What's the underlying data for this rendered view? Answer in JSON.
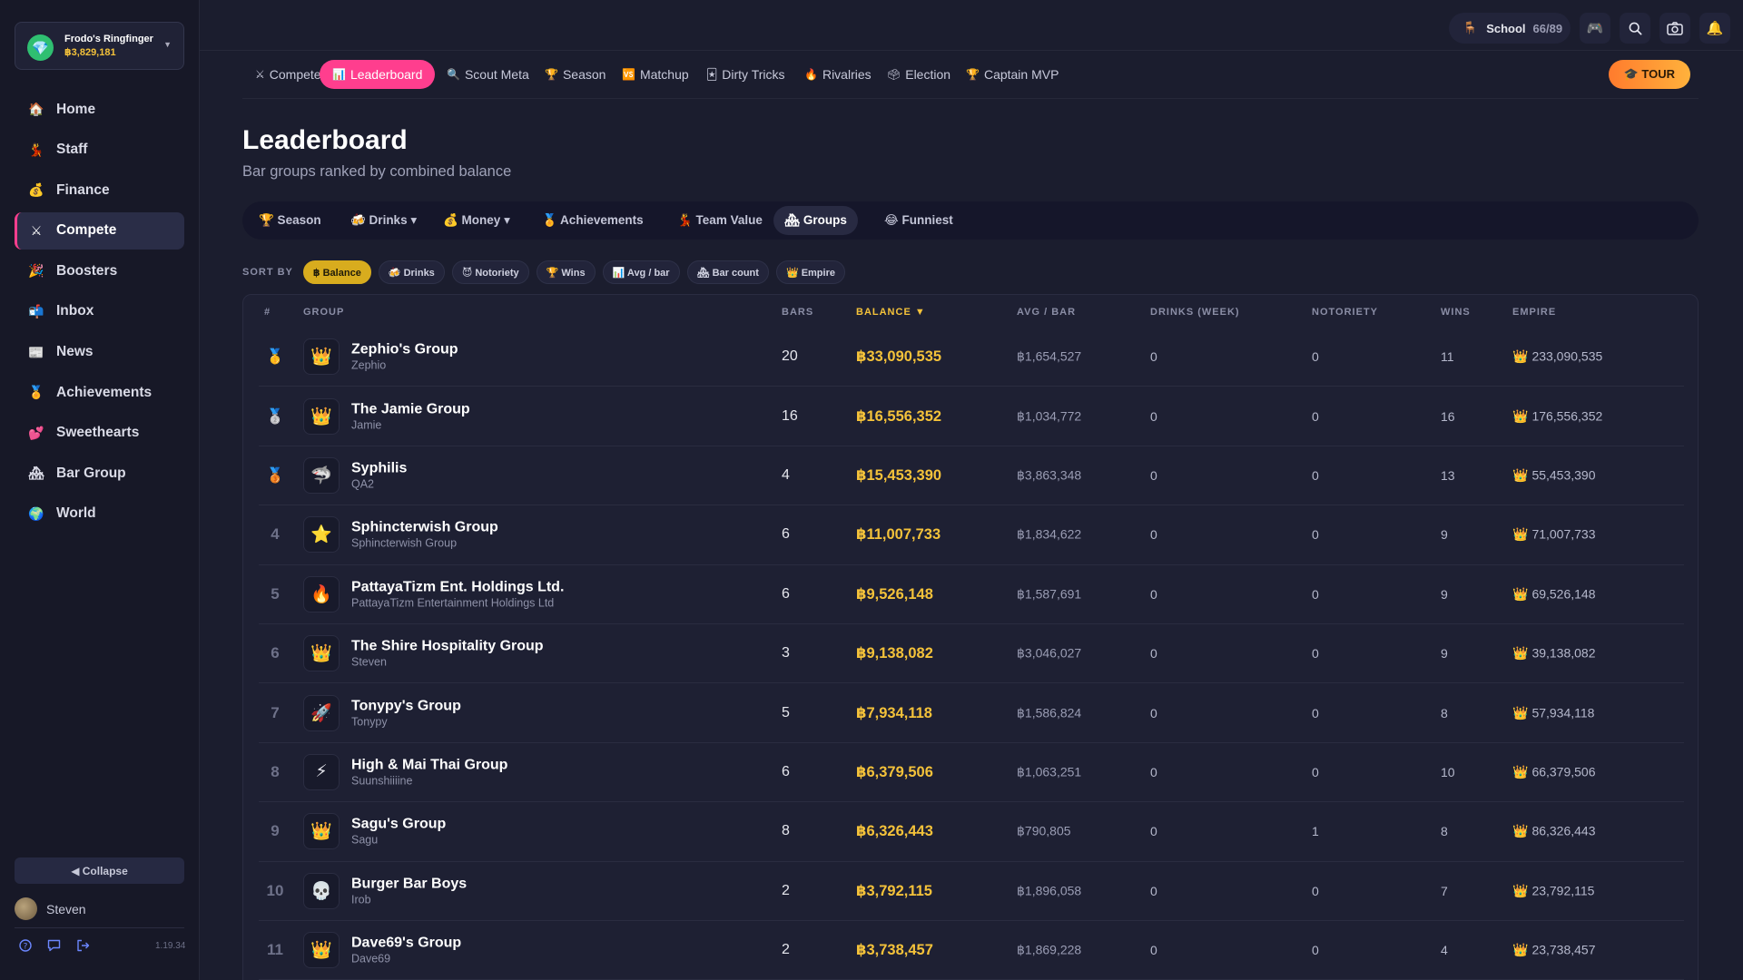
{
  "account": {
    "name": "Frodo's Ringfinger",
    "balance": "฿3,829,181",
    "icon": "diamond-icon"
  },
  "sidebar": {
    "items": [
      {
        "icon": "🏠",
        "label": "Home",
        "name": "sidebar-item-home"
      },
      {
        "icon": "💃",
        "label": "Staff",
        "name": "sidebar-item-staff"
      },
      {
        "icon": "💰",
        "label": "Finance",
        "name": "sidebar-item-finance"
      },
      {
        "icon": "⚔",
        "label": "Compete",
        "name": "sidebar-item-compete",
        "active": true
      },
      {
        "icon": "🎉",
        "label": "Boosters",
        "name": "sidebar-item-boosters"
      },
      {
        "icon": "📬",
        "label": "Inbox",
        "name": "sidebar-item-inbox"
      },
      {
        "icon": "📰",
        "label": "News",
        "name": "sidebar-item-news"
      },
      {
        "icon": "🏅",
        "label": "Achievements",
        "name": "sidebar-item-achievements"
      },
      {
        "icon": "💕",
        "label": "Sweethearts",
        "name": "sidebar-item-sweethearts"
      },
      {
        "icon": "🏘",
        "label": "Bar Group",
        "name": "sidebar-item-bar-group"
      },
      {
        "icon": "🌍",
        "label": "World",
        "name": "sidebar-item-world"
      }
    ],
    "collapse_label": "◀ Collapse",
    "user_name": "Steven",
    "version": "1.19.34"
  },
  "topbar": {
    "school_label": "School",
    "school_count": "66/89"
  },
  "tabs": [
    {
      "icon": "⚔",
      "label": "Compete"
    },
    {
      "icon": "📊",
      "label": "Leaderboard",
      "active": true
    },
    {
      "icon": "🔍",
      "label": "Scout Meta"
    },
    {
      "icon": "🏆",
      "label": "Season"
    },
    {
      "icon": "🆚",
      "label": "Matchup"
    },
    {
      "icon": "🃏",
      "label": "Dirty Tricks"
    },
    {
      "icon": "🔥",
      "label": "Rivalries"
    },
    {
      "icon": "🗳",
      "label": "Election"
    },
    {
      "icon": "🏆",
      "label": "Captain MVP"
    }
  ],
  "tour_label": "🎓 TOUR",
  "page": {
    "title": "Leaderboard",
    "subtitle": "Bar groups ranked by combined balance"
  },
  "subtabs": [
    {
      "label": "🏆 Season"
    },
    {
      "label": "🍻 Drinks ▾"
    },
    {
      "label": "💰 Money ▾"
    },
    {
      "label": "🏅 Achievements"
    },
    {
      "label": "💃 Team Value"
    },
    {
      "label": "🏘 Groups",
      "active": true
    },
    {
      "label": "😂 Funniest"
    }
  ],
  "sort": {
    "label": "SORT BY",
    "chips": [
      {
        "label": "฿ Balance",
        "active": true
      },
      {
        "label": "🍻 Drinks"
      },
      {
        "label": "😈 Notoriety"
      },
      {
        "label": "🏆 Wins"
      },
      {
        "label": "📊 Avg / bar"
      },
      {
        "label": "🏘 Bar count"
      },
      {
        "label": "👑 Empire"
      }
    ]
  },
  "table": {
    "headers": {
      "rank": "#",
      "group": "GROUP",
      "bars": "BARS",
      "balance": "BALANCE ▼",
      "avg": "AVG / BAR",
      "drinks": "DRINKS (WEEK)",
      "notoriety": "NOTORIETY",
      "wins": "WINS",
      "empire": "EMPIRE"
    },
    "rows": [
      {
        "rank": "🥇",
        "medal": true,
        "icon": "👑",
        "name": "Zephio's Group",
        "owner": "Zephio",
        "bars": "20",
        "balance": "฿33,090,535",
        "avg": "฿1,654,527",
        "drinks": "0",
        "notoriety": "0",
        "wins": "11",
        "empire": "233,090,535"
      },
      {
        "rank": "🥈",
        "medal": true,
        "icon": "👑",
        "name": "The Jamie Group",
        "owner": "Jamie",
        "bars": "16",
        "balance": "฿16,556,352",
        "avg": "฿1,034,772",
        "drinks": "0",
        "notoriety": "0",
        "wins": "16",
        "empire": "176,556,352"
      },
      {
        "rank": "🥉",
        "medal": true,
        "icon": "🦈",
        "name": "Syphilis",
        "owner": "QA2",
        "bars": "4",
        "balance": "฿15,453,390",
        "avg": "฿3,863,348",
        "drinks": "0",
        "notoriety": "0",
        "wins": "13",
        "empire": "55,453,390"
      },
      {
        "rank": "4",
        "icon": "⭐",
        "name": "Sphincterwish Group",
        "owner": "Sphincterwish Group",
        "bars": "6",
        "balance": "฿11,007,733",
        "avg": "฿1,834,622",
        "drinks": "0",
        "notoriety": "0",
        "wins": "9",
        "empire": "71,007,733"
      },
      {
        "rank": "5",
        "icon": "🔥",
        "name": "PattayaTizm Ent. Holdings Ltd.",
        "owner": "PattayaTizm Entertainment Holdings Ltd",
        "bars": "6",
        "balance": "฿9,526,148",
        "avg": "฿1,587,691",
        "drinks": "0",
        "notoriety": "0",
        "wins": "9",
        "empire": "69,526,148"
      },
      {
        "rank": "6",
        "icon": "👑",
        "name": "The Shire Hospitality Group",
        "owner": "Steven",
        "bars": "3",
        "balance": "฿9,138,082",
        "avg": "฿3,046,027",
        "drinks": "0",
        "notoriety": "0",
        "wins": "9",
        "empire": "39,138,082"
      },
      {
        "rank": "7",
        "icon": "🚀",
        "name": "Tonypy's Group",
        "owner": "Tonypy",
        "bars": "5",
        "balance": "฿7,934,118",
        "avg": "฿1,586,824",
        "drinks": "0",
        "notoriety": "0",
        "wins": "8",
        "empire": "57,934,118"
      },
      {
        "rank": "8",
        "icon": "⚡",
        "name": "High & Mai Thai Group",
        "owner": "Suunshiiiine",
        "bars": "6",
        "balance": "฿6,379,506",
        "avg": "฿1,063,251",
        "drinks": "0",
        "notoriety": "0",
        "wins": "10",
        "empire": "66,379,506"
      },
      {
        "rank": "9",
        "icon": "👑",
        "name": "Sagu's Group",
        "owner": "Sagu",
        "bars": "8",
        "balance": "฿6,326,443",
        "avg": "฿790,805",
        "drinks": "0",
        "notoriety": "1",
        "wins": "8",
        "empire": "86,326,443"
      },
      {
        "rank": "10",
        "icon": "💀",
        "name": "Burger Bar Boys",
        "owner": "Irob",
        "bars": "2",
        "balance": "฿3,792,115",
        "avg": "฿1,896,058",
        "drinks": "0",
        "notoriety": "0",
        "wins": "7",
        "empire": "23,792,115"
      },
      {
        "rank": "11",
        "icon": "👑",
        "name": "Dave69's Group",
        "owner": "Dave69",
        "bars": "2",
        "balance": "฿3,738,457",
        "avg": "฿1,869,228",
        "drinks": "0",
        "notoriety": "0",
        "wins": "4",
        "empire": "23,738,457"
      }
    ]
  }
}
